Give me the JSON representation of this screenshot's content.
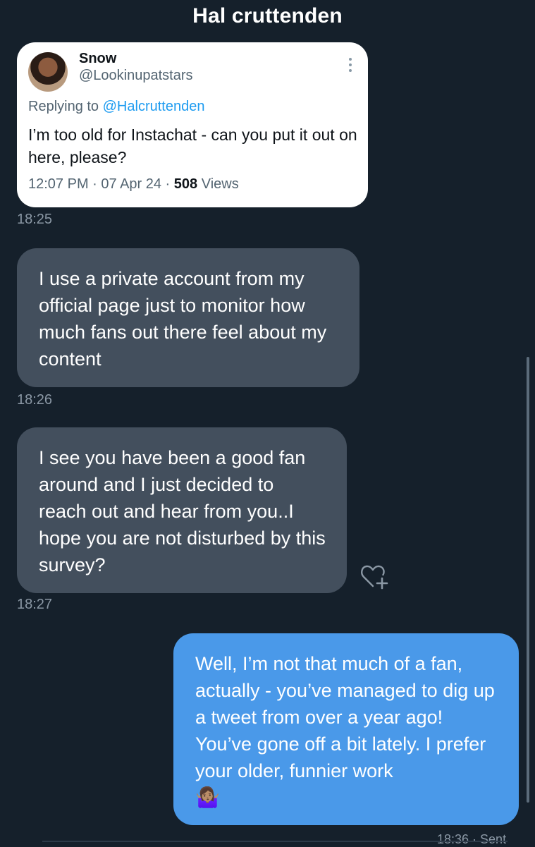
{
  "header": {
    "title": "Hal cruttenden"
  },
  "quoted_tweet": {
    "name": "Snow",
    "handle": "@Lookinupatstars",
    "reply_prefix": "Replying to ",
    "reply_handle": "@Halcruttenden",
    "text": "I’m too old for Instachat - can you put it out on here, please?",
    "time_date": "12:07 PM · 07 Apr 24 · ",
    "views_count": "508",
    "views_label": " Views"
  },
  "messages": [
    {
      "direction": "in",
      "timestamp": "18:25"
    },
    {
      "direction": "in",
      "text": "I use a private account from my official page just to monitor how much fans out there feel about my content",
      "timestamp": "18:26"
    },
    {
      "direction": "in",
      "text": "I see you have been a good fan around and I just decided to reach out and hear from you..I hope you are not disturbed by this survey?",
      "timestamp": "18:27"
    },
    {
      "direction": "out",
      "text": "Well, I’m not that much of a fan, actually - you’ve managed to dig up a tweet from over a year ago! You’ve gone off a bit lately. I prefer your older, funnier work",
      "emoji": "🤷🏽‍♀️",
      "timestamp_partial": "18:36 · Sent"
    }
  ],
  "icons": {
    "more": "more-vertical-icon",
    "react": "heart-add-icon"
  },
  "colors": {
    "background": "#15202b",
    "incoming_bubble": "#434f5d",
    "outgoing_bubble": "#4a99e9",
    "link": "#1d9bf0"
  }
}
